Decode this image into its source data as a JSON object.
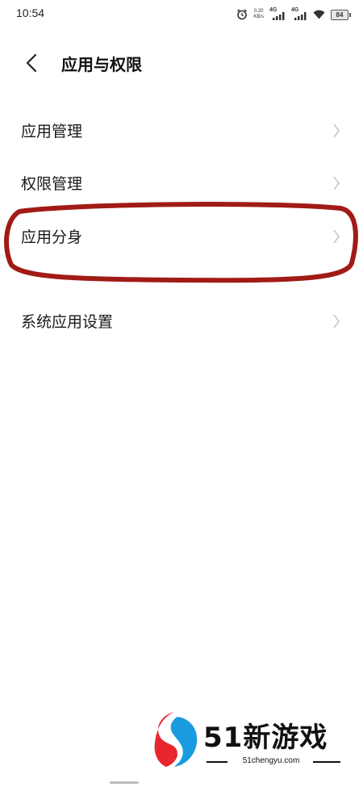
{
  "status_bar": {
    "time": "10:54",
    "net_speed_value": "0.20",
    "net_speed_unit": "KB/s",
    "sim1_label": "4G",
    "sim2_label": "4G",
    "battery_level": "84",
    "icons": [
      "alarm-icon",
      "signal-icon",
      "wifi-icon",
      "battery-icon"
    ]
  },
  "header": {
    "back_icon": "chevron-left-icon",
    "title": "应用与权限"
  },
  "menu": {
    "items": [
      {
        "label": "应用管理"
      },
      {
        "label": "权限管理"
      },
      {
        "label": "应用分身"
      },
      {
        "label": "系统应用设置"
      }
    ]
  },
  "annotation": {
    "highlight_color": "#a11b16"
  },
  "watermark": {
    "title": "51新游戏",
    "url": "51chengyu.com",
    "logo_colors": [
      "#e8262b",
      "#1a9be0"
    ]
  }
}
